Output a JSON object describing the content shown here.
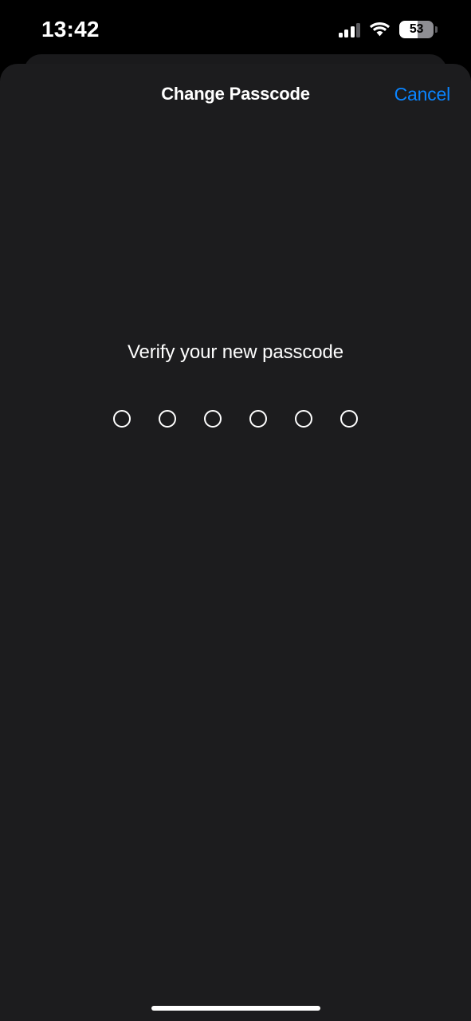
{
  "status_bar": {
    "time": "13:42",
    "cellular_icon": "cellular-signal-icon",
    "cellular_bars_active": 3,
    "cellular_bars_total": 4,
    "wifi_icon": "wifi-icon",
    "battery": {
      "level_text": "53",
      "level_percent": 53,
      "icon": "battery-icon"
    }
  },
  "sheet": {
    "title": "Change Passcode",
    "cancel_label": "Cancel",
    "prompt": "Verify your new passcode",
    "passcode": {
      "length": 6,
      "entered": 0,
      "dots": [
        {
          "filled": false
        },
        {
          "filled": false
        },
        {
          "filled": false
        },
        {
          "filled": false
        },
        {
          "filled": false
        },
        {
          "filled": false
        }
      ]
    }
  },
  "colors": {
    "background": "#000000",
    "sheet_background": "#1c1c1e",
    "sheet_behind_background": "#1a1a1c",
    "accent_blue": "#0a84ff",
    "text_primary": "#ffffff",
    "battery_track": "#8e8e93",
    "battery_fill": "#ffffff"
  },
  "home_indicator": {
    "label": "home-indicator"
  }
}
